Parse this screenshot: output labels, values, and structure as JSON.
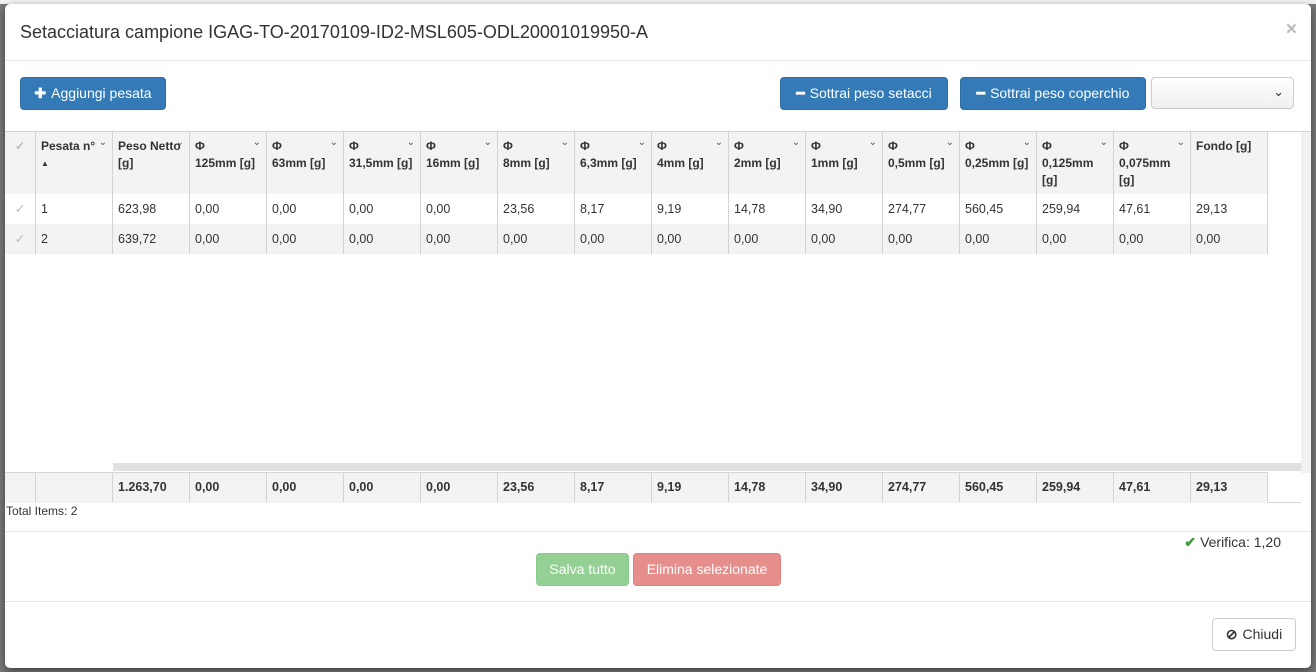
{
  "modal": {
    "title": "Setacciatura campione IGAG-TO-20170109-ID2-MSL605-ODL20001019950-A",
    "close_symbol": "×"
  },
  "toolbar": {
    "add_label": "Aggiungi pesata",
    "add_icon": "plus-icon",
    "subtract_sieves_label": "Sottrai peso setacci",
    "subtract_lid_label": "Sottrai peso coperchio",
    "minus_icon": "minus-icon",
    "select_value": ""
  },
  "grid": {
    "columns": [
      {
        "phi": "",
        "label": "Pesata n°"
      },
      {
        "phi": "",
        "label": "Peso Netto [g]"
      },
      {
        "phi": "Φ",
        "label": "125mm [g]"
      },
      {
        "phi": "Φ",
        "label": "63mm [g]"
      },
      {
        "phi": "Φ",
        "label": "31,5mm [g]"
      },
      {
        "phi": "Φ",
        "label": "16mm [g]"
      },
      {
        "phi": "Φ",
        "label": "8mm [g]"
      },
      {
        "phi": "Φ",
        "label": "6,3mm [g]"
      },
      {
        "phi": "Φ",
        "label": "4mm [g]"
      },
      {
        "phi": "Φ",
        "label": "2mm [g]"
      },
      {
        "phi": "Φ",
        "label": "1mm [g]"
      },
      {
        "phi": "Φ",
        "label": "0,5mm [g]"
      },
      {
        "phi": "Φ",
        "label": "0,25mm [g]"
      },
      {
        "phi": "Φ",
        "label": "0,125mm [g]"
      },
      {
        "phi": "Φ",
        "label": "0,075mm [g]"
      },
      {
        "phi": "",
        "label": "Fondo [g]"
      }
    ],
    "rows": [
      [
        "1",
        "623,98",
        "0,00",
        "0,00",
        "0,00",
        "0,00",
        "23,56",
        "8,17",
        "9,19",
        "14,78",
        "34,90",
        "274,77",
        "560,45",
        "259,94",
        "47,61",
        "29,13"
      ],
      [
        "2",
        "639,72",
        "0,00",
        "0,00",
        "0,00",
        "0,00",
        "0,00",
        "0,00",
        "0,00",
        "0,00",
        "0,00",
        "0,00",
        "0,00",
        "0,00",
        "0,00",
        "0,00"
      ]
    ],
    "totals": [
      "",
      "1.263,70",
      "0,00",
      "0,00",
      "0,00",
      "0,00",
      "23,56",
      "8,17",
      "9,19",
      "14,78",
      "34,90",
      "274,77",
      "560,45",
      "259,94",
      "47,61",
      "29,13"
    ],
    "total_items": "Total Items: 2"
  },
  "verification": {
    "icon": "check-icon",
    "text": "Verifica: 1,20",
    "color": "#3c9a3c"
  },
  "actions": {
    "save_all": "Salva tutto",
    "delete_selected": "Elimina selezionate",
    "close": "Chiudi",
    "close_icon": "ban-icon"
  },
  "colors": {
    "primary": "#337ab7",
    "success": "#5cb85c",
    "danger": "#d9534f"
  }
}
